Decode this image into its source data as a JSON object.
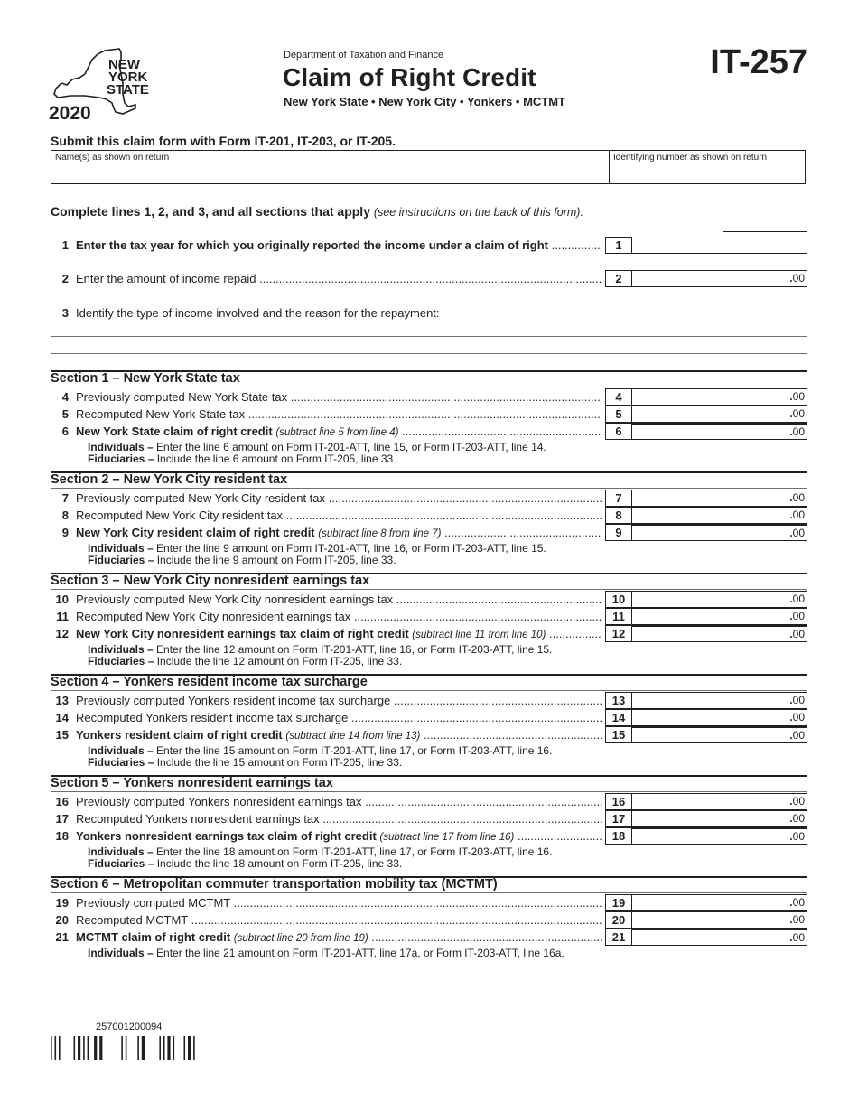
{
  "header": {
    "logo_text": [
      "NEW",
      "YORK",
      "STATE"
    ],
    "year": "2020",
    "department": "Department of Taxation and Finance",
    "title": "Claim of Right Credit",
    "subtitle": "New York State • New York City • Yonkers • MCTMT",
    "form_number": "IT-257"
  },
  "submit_note": "Submit this claim form with Form IT-201, IT-203, or IT-205.",
  "identity": {
    "name_label": "Name(s) as shown on return",
    "name_value": "",
    "id_label": "Identifying number as shown on return",
    "id_value": ""
  },
  "instructions": {
    "bold": "Complete lines 1, 2, and 3, and all sections that apply",
    "italic": "(see instructions on the back of this form)."
  },
  "lines_top": [
    {
      "num": "1",
      "text": "Enter the tax year for which you originally reported the income under a claim of right",
      "box": "1",
      "value": ""
    },
    {
      "num": "2",
      "text": "Enter the amount of income repaid",
      "box": "2",
      "value": ".00"
    },
    {
      "num": "3",
      "text": "Identify the type of income involved and the reason for the repayment:"
    }
  ],
  "sections": [
    {
      "title": "Section 1 – New York State tax",
      "lines": [
        {
          "num": "4",
          "text": "Previously computed New York State tax",
          "value": ".00"
        },
        {
          "num": "5",
          "text": "Recomputed New York State tax",
          "value": ".00"
        },
        {
          "num": "6",
          "text": "New York State claim of right credit",
          "hint": "(subtract line 5 from line 4)",
          "value": ".00"
        }
      ],
      "notes": [
        {
          "label": "Individuals –",
          "text": " Enter the line 6 amount on Form IT-201-ATT, line 15, or Form IT-203-ATT, line 14."
        },
        {
          "label": "Fiduciaries –",
          "text": " Include the line 6 amount on Form IT-205, line 33."
        }
      ]
    },
    {
      "title": "Section 2 – New York City resident tax",
      "lines": [
        {
          "num": "7",
          "text": "Previously computed New York City resident tax",
          "value": ".00"
        },
        {
          "num": "8",
          "text": "Recomputed New York City resident tax",
          "value": ".00"
        },
        {
          "num": "9",
          "text": "New York City resident claim of right credit",
          "hint": "(subtract line 8 from line 7)",
          "value": ".00"
        }
      ],
      "notes": [
        {
          "label": "Individuals –",
          "text": " Enter the line 9 amount on Form IT-201-ATT, line 16, or Form IT-203-ATT, line 15."
        },
        {
          "label": "Fiduciaries –",
          "text": " Include the line 9 amount on Form IT-205, line 33."
        }
      ]
    },
    {
      "title": "Section 3 – New York City nonresident earnings tax",
      "lines": [
        {
          "num": "10",
          "text": "Previously computed New York City nonresident earnings tax",
          "value": ".00"
        },
        {
          "num": "11",
          "text": "Recomputed New York City nonresident earnings tax",
          "value": ".00"
        },
        {
          "num": "12",
          "text": "New York City nonresident earnings tax claim of right credit",
          "hint": "(subtract line 11 from line 10)",
          "value": ".00"
        }
      ],
      "notes": [
        {
          "label": "Individuals –",
          "text": " Enter the line 12 amount on Form IT-201-ATT, line 16, or Form IT-203-ATT, line 15."
        },
        {
          "label": "Fiduciaries –",
          "text": " Include the line 12 amount on Form IT-205, line 33."
        }
      ]
    },
    {
      "title": "Section 4 – Yonkers resident income tax surcharge",
      "lines": [
        {
          "num": "13",
          "text": "Previously computed Yonkers resident income tax surcharge",
          "value": ".00"
        },
        {
          "num": "14",
          "text": "Recomputed Yonkers resident income tax surcharge",
          "value": ".00"
        },
        {
          "num": "15",
          "text": "Yonkers resident claim of right credit",
          "hint": "(subtract line 14 from line 13)",
          "value": ".00"
        }
      ],
      "notes": [
        {
          "label": "Individuals –",
          "text": " Enter the line 15 amount on Form IT-201-ATT, line 17, or Form IT-203-ATT, line 16."
        },
        {
          "label": "Fiduciaries –",
          "text": " Include the line 15 amount on Form IT-205, line 33."
        }
      ]
    },
    {
      "title": "Section 5 – Yonkers nonresident earnings tax",
      "lines": [
        {
          "num": "16",
          "text": "Previously computed Yonkers nonresident earnings tax",
          "value": ".00"
        },
        {
          "num": "17",
          "text": "Recomputed Yonkers nonresident earnings tax",
          "value": ".00"
        },
        {
          "num": "18",
          "text": "Yonkers nonresident earnings tax claim of right credit",
          "hint": "(subtract line 17 from line 16)",
          "value": ".00"
        }
      ],
      "notes": [
        {
          "label": "Individuals –",
          "text": " Enter the line 18 amount on Form IT-201-ATT, line 17, or Form IT-203-ATT, line 16."
        },
        {
          "label": "Fiduciaries –",
          "text": " Include the line 18 amount on Form IT-205, line 33."
        }
      ]
    },
    {
      "title": "Section 6 – Metropolitan commuter transportation mobility tax (MCTMT)",
      "lines": [
        {
          "num": "19",
          "text": "Previously computed MCTMT",
          "value": ".00"
        },
        {
          "num": "20",
          "text": "Recomputed MCTMT",
          "value": ".00"
        },
        {
          "num": "21",
          "text": "MCTMT claim of right credit",
          "hint": "(subtract line 20 from line 19)",
          "value": ".00"
        }
      ],
      "notes": [
        {
          "label": "Individuals –",
          "text": " Enter the line 21 amount on Form IT-201-ATT, line 17a, or Form IT-203-ATT, line 16a."
        }
      ]
    }
  ],
  "barcode": {
    "number": "257001200094"
  }
}
